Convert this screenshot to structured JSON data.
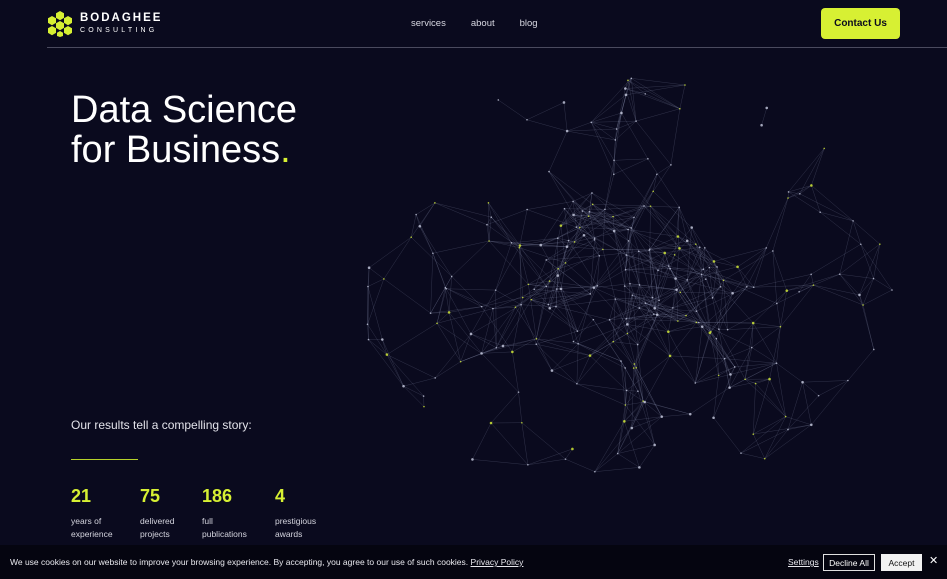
{
  "brand": {
    "name": "BODAGHEE",
    "sub": "CONSULTING",
    "accent": "#d7f033"
  },
  "nav": [
    {
      "label": "services"
    },
    {
      "label": "about"
    },
    {
      "label": "blog"
    }
  ],
  "header": {
    "contact_label": "Contact Us"
  },
  "hero": {
    "line1": "Data Science",
    "line2": "for Business",
    "dot": "."
  },
  "results": {
    "intro": "Our results tell a compelling story:"
  },
  "stats": [
    {
      "value": "21",
      "label1": "years of",
      "label2": "experience"
    },
    {
      "value": "75",
      "label1": "delivered",
      "label2": "projects"
    },
    {
      "value": "186",
      "label1": "full",
      "label2": "publications"
    },
    {
      "value": "4",
      "label1": "prestigious",
      "label2": "awards"
    }
  ],
  "cookie": {
    "text": "We use cookies on our website to improve your browsing experience. By accepting, you agree to our use of such cookies.",
    "policy_link": "Privacy Policy",
    "settings_label": "Settings",
    "decline_label": "Decline All",
    "accept_label": "Accept",
    "close_icon": "close-icon"
  }
}
